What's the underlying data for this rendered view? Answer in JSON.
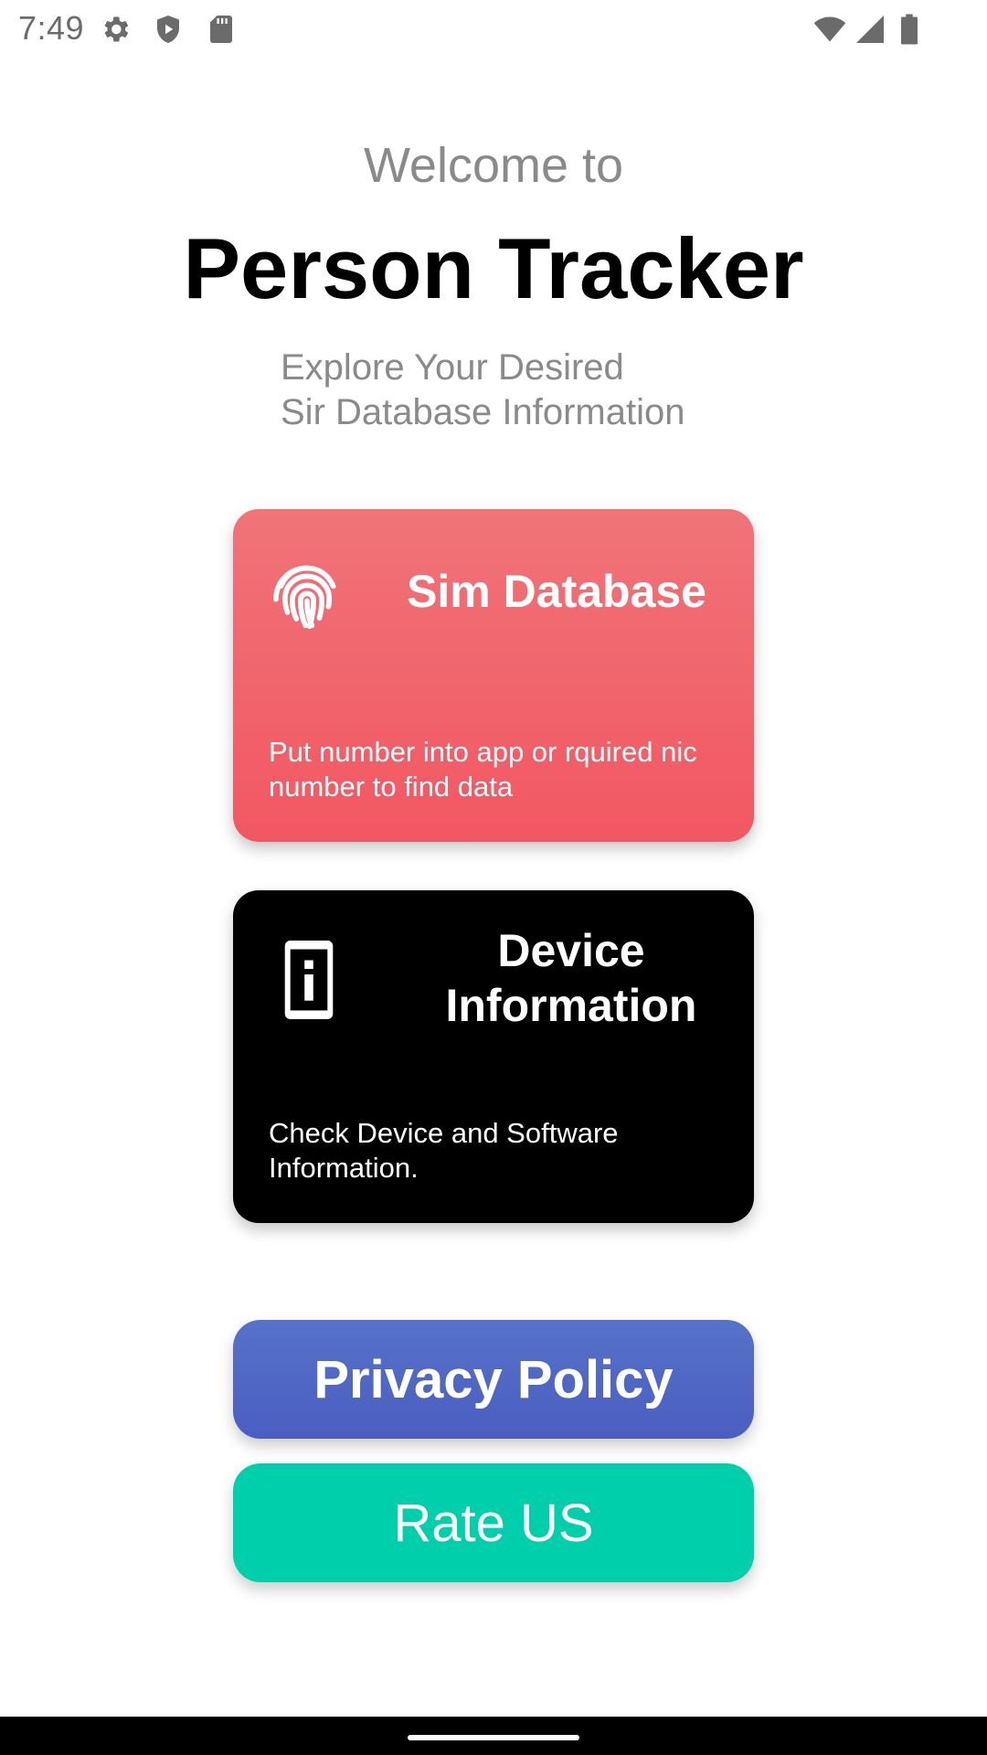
{
  "status_bar": {
    "time": "7:49",
    "icons_left": [
      "gear-icon",
      "shield-play-icon",
      "sd-card-icon"
    ],
    "icons_right": [
      "wifi-icon",
      "signal-icon",
      "battery-icon"
    ]
  },
  "header": {
    "welcome": "Welcome to",
    "title": "Person Tracker",
    "subtitle_line1": "Explore Your Desired",
    "subtitle_line2": "Sir Database Information"
  },
  "cards": {
    "sim": {
      "icon": "fingerprint-icon",
      "title": "Sim Database",
      "description": "Put number into app or rquired nic number to find data",
      "gradient_top": "#f07478",
      "gradient_bottom": "#f25762"
    },
    "device": {
      "icon": "device-info-icon",
      "title": "Device Information",
      "description": "Check Device and Software Information.",
      "background": "#000000"
    }
  },
  "buttons": {
    "privacy": {
      "label": "Privacy Policy",
      "color": "#4f66c4"
    },
    "rate": {
      "label": "Rate US",
      "color": "#00cfac"
    }
  }
}
